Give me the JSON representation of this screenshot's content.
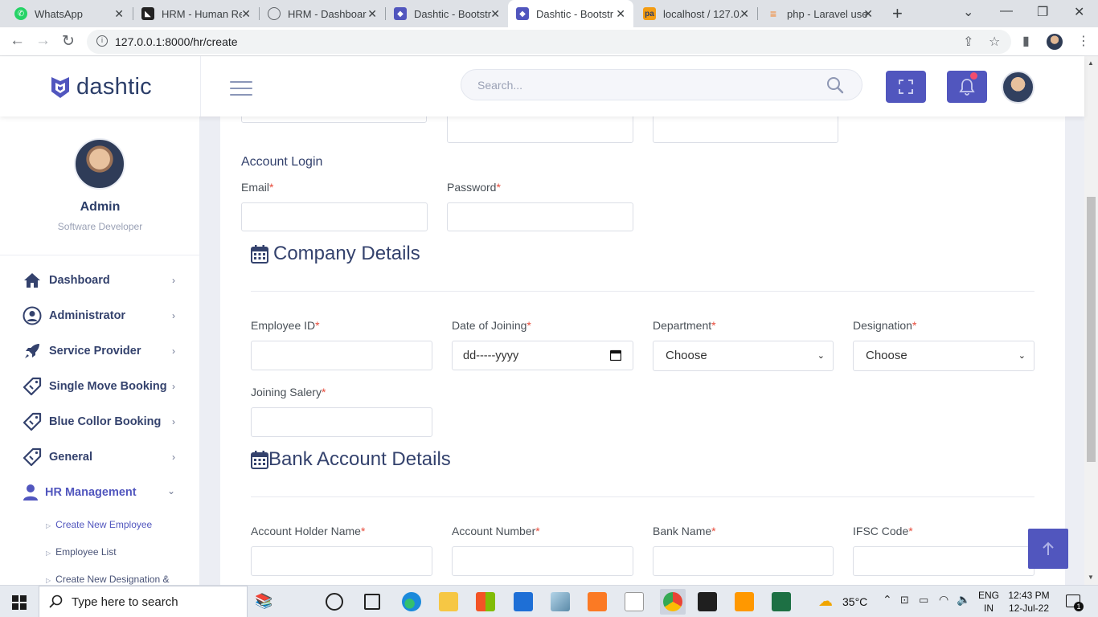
{
  "browser": {
    "tabs": [
      {
        "title": "WhatsApp",
        "icon": "whatsapp-icon"
      },
      {
        "title": "HRM - Human Re",
        "icon": "hrm-icon"
      },
      {
        "title": "HRM - Dashboar",
        "icon": "globe-icon"
      },
      {
        "title": "Dashtic - Bootstr",
        "icon": "dashtic-icon"
      },
      {
        "title": "Dashtic - Bootstr",
        "icon": "dashtic-icon"
      },
      {
        "title": "localhost / 127.0.",
        "icon": "phpmyadmin-icon"
      },
      {
        "title": "php - Laravel use",
        "icon": "stackoverflow-icon"
      }
    ],
    "url": "127.0.0.1:8000/hr/create"
  },
  "header": {
    "logo_text": "dashtic",
    "search_placeholder": "Search..."
  },
  "sidebar": {
    "profile_name": "Admin",
    "profile_role": "Software Developer",
    "items": [
      {
        "label": "Dashboard",
        "icon": "home-icon"
      },
      {
        "label": "Administrator",
        "icon": "user-circle-icon"
      },
      {
        "label": "Service Provider",
        "icon": "rocket-icon"
      },
      {
        "label": "Single Move Booking",
        "icon": "tag-icon"
      },
      {
        "label": "Blue Collor Booking",
        "icon": "tag-icon"
      },
      {
        "label": "General",
        "icon": "tag-icon"
      },
      {
        "label": "HR Management",
        "icon": "user-icon"
      }
    ],
    "submenu": [
      {
        "label": "Create New Employee"
      },
      {
        "label": "Employee List"
      },
      {
        "label": "Create New Designation &"
      }
    ]
  },
  "form": {
    "account_login_title": "Account Login",
    "email_label": "Email",
    "password_label": "Password",
    "required_mark": "*",
    "company_title": "Company Details",
    "employee_id_label": "Employee ID",
    "doj_label": "Date of Joining",
    "doj_placeholder": "dd-----yyyy",
    "department_label": "Department",
    "department_value": "Choose",
    "designation_label": "Designation",
    "designation_value": "Choose",
    "salary_label": "Joining Salery",
    "bank_title": "Bank Account Details",
    "holder_label": "Account Holder Name",
    "acc_number_label": "Account Number",
    "bank_name_label": "Bank Name",
    "ifsc_label": "IFSC Code"
  },
  "taskbar": {
    "search_text": "Type here to search",
    "weather": "35°C",
    "lang_top": "ENG",
    "lang_bottom": "IN",
    "time": "12:43 PM",
    "date": "12-Jul-22",
    "notif_count": "1"
  },
  "colors": {
    "accent": "#5156be",
    "heading": "#34426d",
    "required": "#e74c3c"
  }
}
